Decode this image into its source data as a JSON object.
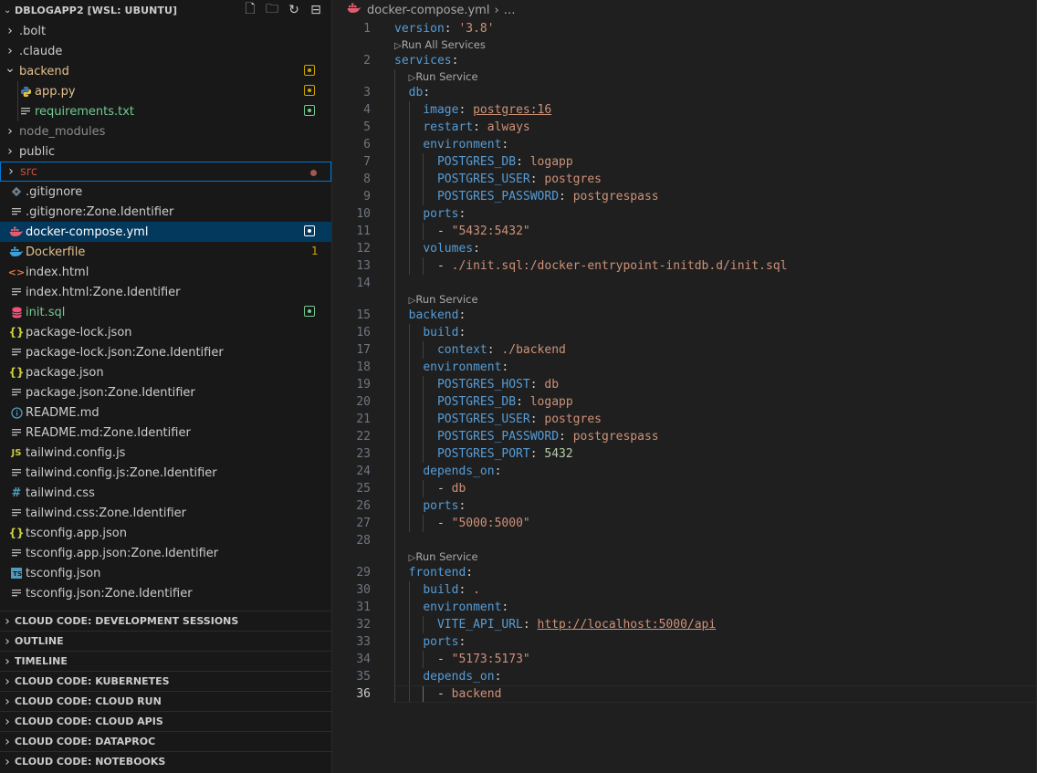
{
  "explorer": {
    "title": "DBLOGAPP2 [WSL: UBUNTU]",
    "actions": [
      {
        "name": "new-file-icon",
        "glyph": "🗋"
      },
      {
        "name": "new-folder-icon",
        "glyph": "🗀"
      },
      {
        "name": "refresh-icon",
        "glyph": "↻"
      },
      {
        "name": "collapse-all-icon",
        "glyph": "⊟"
      }
    ],
    "items": [
      {
        "label": ".bolt",
        "depth": 0,
        "folder": true,
        "open": false,
        "color": "#cccccc"
      },
      {
        "label": ".claude",
        "depth": 0,
        "folder": true,
        "open": false,
        "color": "#cccccc"
      },
      {
        "label": "backend",
        "depth": 0,
        "folder": true,
        "open": true,
        "color": "#e2c08d",
        "badge": "#cca700"
      },
      {
        "label": "app.py",
        "depth": 1,
        "icon": "python",
        "color": "#e2c08d",
        "badge": "#cca700"
      },
      {
        "label": "requirements.txt",
        "depth": 1,
        "icon": "lines",
        "color": "#73c991",
        "badge": "#73c991"
      },
      {
        "label": "node_modules",
        "depth": 0,
        "folder": true,
        "open": false,
        "color": "#8c8c8c"
      },
      {
        "label": "public",
        "depth": 0,
        "folder": true,
        "open": false,
        "color": "#cccccc"
      },
      {
        "label": "src",
        "depth": 0,
        "folder": true,
        "open": false,
        "color": "#c74e39",
        "dot": true,
        "focus": true
      },
      {
        "label": ".gitignore",
        "depth": 0,
        "icon": "git",
        "color": "#cccccc"
      },
      {
        "label": ".gitignore:Zone.Identifier",
        "depth": 0,
        "icon": "lines",
        "color": "#cccccc"
      },
      {
        "label": "docker-compose.yml",
        "depth": 0,
        "icon": "docker-red",
        "color": "#ffffff",
        "badge": "#ffffff",
        "selected": true
      },
      {
        "label": "Dockerfile",
        "depth": 0,
        "icon": "docker",
        "color": "#e2c08d",
        "count": "1"
      },
      {
        "label": "index.html",
        "depth": 0,
        "icon": "html",
        "color": "#cccccc"
      },
      {
        "label": "index.html:Zone.Identifier",
        "depth": 0,
        "icon": "lines",
        "color": "#cccccc"
      },
      {
        "label": "init.sql",
        "depth": 0,
        "icon": "db",
        "color": "#73c991",
        "badge": "#73c991"
      },
      {
        "label": "package-lock.json",
        "depth": 0,
        "icon": "json",
        "color": "#cccccc"
      },
      {
        "label": "package-lock.json:Zone.Identifier",
        "depth": 0,
        "icon": "lines",
        "color": "#cccccc"
      },
      {
        "label": "package.json",
        "depth": 0,
        "icon": "json",
        "color": "#cccccc"
      },
      {
        "label": "package.json:Zone.Identifier",
        "depth": 0,
        "icon": "lines",
        "color": "#cccccc"
      },
      {
        "label": "README.md",
        "depth": 0,
        "icon": "info",
        "color": "#cccccc"
      },
      {
        "label": "README.md:Zone.Identifier",
        "depth": 0,
        "icon": "lines",
        "color": "#cccccc"
      },
      {
        "label": "tailwind.config.js",
        "depth": 0,
        "icon": "js",
        "color": "#cccccc"
      },
      {
        "label": "tailwind.config.js:Zone.Identifier",
        "depth": 0,
        "icon": "lines",
        "color": "#cccccc"
      },
      {
        "label": "tailwind.css",
        "depth": 0,
        "icon": "css",
        "color": "#cccccc"
      },
      {
        "label": "tailwind.css:Zone.Identifier",
        "depth": 0,
        "icon": "lines",
        "color": "#cccccc"
      },
      {
        "label": "tsconfig.app.json",
        "depth": 0,
        "icon": "json",
        "color": "#cccccc"
      },
      {
        "label": "tsconfig.app.json:Zone.Identifier",
        "depth": 0,
        "icon": "lines",
        "color": "#cccccc"
      },
      {
        "label": "tsconfig.json",
        "depth": 0,
        "icon": "ts",
        "color": "#cccccc"
      },
      {
        "label": "tsconfig.json:Zone.Identifier",
        "depth": 0,
        "icon": "lines",
        "color": "#cccccc"
      }
    ]
  },
  "panels": [
    "CLOUD CODE: DEVELOPMENT SESSIONS",
    "OUTLINE",
    "TIMELINE",
    "CLOUD CODE: KUBERNETES",
    "CLOUD CODE: CLOUD RUN",
    "CLOUD CODE: CLOUD APIS",
    "CLOUD CODE: DATAPROC",
    "CLOUD CODE: NOTEBOOKS"
  ],
  "breadcrumb": {
    "file": "docker-compose.yml",
    "rest": "…"
  },
  "editor": {
    "current_line": 36,
    "lines": [
      {
        "ln": "1",
        "indent": 0,
        "tokens": [
          [
            "k",
            "version"
          ],
          [
            "p",
            ": "
          ],
          [
            "s",
            "'3.8'"
          ]
        ]
      },
      {
        "lens": "Run All Services",
        "indent": 0
      },
      {
        "ln": "2",
        "indent": 0,
        "tokens": [
          [
            "k",
            "services"
          ],
          [
            "p",
            ":"
          ]
        ]
      },
      {
        "lens": "Run Service",
        "indent": 1
      },
      {
        "ln": "3",
        "indent": 1,
        "tokens": [
          [
            "k",
            "db"
          ],
          [
            "p",
            ":"
          ]
        ]
      },
      {
        "ln": "4",
        "indent": 2,
        "tokens": [
          [
            "k",
            "image"
          ],
          [
            "p",
            ": "
          ],
          [
            "su",
            "postgres:16"
          ]
        ]
      },
      {
        "ln": "5",
        "indent": 2,
        "tokens": [
          [
            "k",
            "restart"
          ],
          [
            "p",
            ": "
          ],
          [
            "s",
            "always"
          ]
        ]
      },
      {
        "ln": "6",
        "indent": 2,
        "tokens": [
          [
            "k",
            "environment"
          ],
          [
            "p",
            ":"
          ]
        ]
      },
      {
        "ln": "7",
        "indent": 3,
        "tokens": [
          [
            "k",
            "POSTGRES_DB"
          ],
          [
            "p",
            ": "
          ],
          [
            "s",
            "logapp"
          ]
        ]
      },
      {
        "ln": "8",
        "indent": 3,
        "tokens": [
          [
            "k",
            "POSTGRES_USER"
          ],
          [
            "p",
            ": "
          ],
          [
            "s",
            "postgres"
          ]
        ]
      },
      {
        "ln": "9",
        "indent": 3,
        "tokens": [
          [
            "k",
            "POSTGRES_PASSWORD"
          ],
          [
            "p",
            ": "
          ],
          [
            "s",
            "postgrespass"
          ]
        ]
      },
      {
        "ln": "10",
        "indent": 2,
        "tokens": [
          [
            "k",
            "ports"
          ],
          [
            "p",
            ":"
          ]
        ]
      },
      {
        "ln": "11",
        "indent": 3,
        "tokens": [
          [
            "p",
            "- "
          ],
          [
            "s",
            "\"5432:5432\""
          ]
        ]
      },
      {
        "ln": "12",
        "indent": 2,
        "tokens": [
          [
            "k",
            "volumes"
          ],
          [
            "p",
            ":"
          ]
        ]
      },
      {
        "ln": "13",
        "indent": 3,
        "tokens": [
          [
            "p",
            "- "
          ],
          [
            "s",
            "./init.sql:/docker-entrypoint-initdb.d/init.sql"
          ]
        ]
      },
      {
        "ln": "14",
        "indent": 0,
        "guides": 1,
        "tokens": []
      },
      {
        "lens": "Run Service",
        "indent": 1
      },
      {
        "ln": "15",
        "indent": 1,
        "tokens": [
          [
            "k",
            "backend"
          ],
          [
            "p",
            ":"
          ]
        ]
      },
      {
        "ln": "16",
        "indent": 2,
        "tokens": [
          [
            "k",
            "build"
          ],
          [
            "p",
            ":"
          ]
        ]
      },
      {
        "ln": "17",
        "indent": 3,
        "tokens": [
          [
            "k",
            "context"
          ],
          [
            "p",
            ": "
          ],
          [
            "s",
            "./backend"
          ]
        ]
      },
      {
        "ln": "18",
        "indent": 2,
        "tokens": [
          [
            "k",
            "environment"
          ],
          [
            "p",
            ":"
          ]
        ]
      },
      {
        "ln": "19",
        "indent": 3,
        "tokens": [
          [
            "k",
            "POSTGRES_HOST"
          ],
          [
            "p",
            ": "
          ],
          [
            "s",
            "db"
          ]
        ]
      },
      {
        "ln": "20",
        "indent": 3,
        "tokens": [
          [
            "k",
            "POSTGRES_DB"
          ],
          [
            "p",
            ": "
          ],
          [
            "s",
            "logapp"
          ]
        ]
      },
      {
        "ln": "21",
        "indent": 3,
        "tokens": [
          [
            "k",
            "POSTGRES_USER"
          ],
          [
            "p",
            ": "
          ],
          [
            "s",
            "postgres"
          ]
        ]
      },
      {
        "ln": "22",
        "indent": 3,
        "tokens": [
          [
            "k",
            "POSTGRES_PASSWORD"
          ],
          [
            "p",
            ": "
          ],
          [
            "s",
            "postgrespass"
          ]
        ]
      },
      {
        "ln": "23",
        "indent": 3,
        "tokens": [
          [
            "k",
            "POSTGRES_PORT"
          ],
          [
            "p",
            ": "
          ],
          [
            "n",
            "5432"
          ]
        ]
      },
      {
        "ln": "24",
        "indent": 2,
        "tokens": [
          [
            "k",
            "depends_on"
          ],
          [
            "p",
            ":"
          ]
        ]
      },
      {
        "ln": "25",
        "indent": 3,
        "tokens": [
          [
            "p",
            "- "
          ],
          [
            "s",
            "db"
          ]
        ]
      },
      {
        "ln": "26",
        "indent": 2,
        "tokens": [
          [
            "k",
            "ports"
          ],
          [
            "p",
            ":"
          ]
        ]
      },
      {
        "ln": "27",
        "indent": 3,
        "tokens": [
          [
            "p",
            "- "
          ],
          [
            "s",
            "\"5000:5000\""
          ]
        ]
      },
      {
        "ln": "28",
        "indent": 0,
        "guides": 1,
        "tokens": []
      },
      {
        "lens": "Run Service",
        "indent": 1
      },
      {
        "ln": "29",
        "indent": 1,
        "tokens": [
          [
            "k",
            "frontend"
          ],
          [
            "p",
            ":"
          ]
        ]
      },
      {
        "ln": "30",
        "indent": 2,
        "tokens": [
          [
            "k",
            "build"
          ],
          [
            "p",
            ": "
          ],
          [
            "s",
            "."
          ]
        ]
      },
      {
        "ln": "31",
        "indent": 2,
        "tokens": [
          [
            "k",
            "environment"
          ],
          [
            "p",
            ":"
          ]
        ]
      },
      {
        "ln": "32",
        "indent": 3,
        "tokens": [
          [
            "k",
            "VITE_API_URL"
          ],
          [
            "p",
            ": "
          ],
          [
            "su",
            "http://localhost:5000/api"
          ]
        ]
      },
      {
        "ln": "33",
        "indent": 2,
        "tokens": [
          [
            "k",
            "ports"
          ],
          [
            "p",
            ":"
          ]
        ]
      },
      {
        "ln": "34",
        "indent": 3,
        "tokens": [
          [
            "p",
            "- "
          ],
          [
            "s",
            "\"5173:5173\""
          ]
        ]
      },
      {
        "ln": "35",
        "indent": 2,
        "tokens": [
          [
            "k",
            "depends_on"
          ],
          [
            "p",
            ":"
          ]
        ]
      },
      {
        "ln": "36",
        "indent": 3,
        "tokens": [
          [
            "p",
            "- "
          ],
          [
            "s",
            "backend"
          ]
        ]
      }
    ]
  }
}
